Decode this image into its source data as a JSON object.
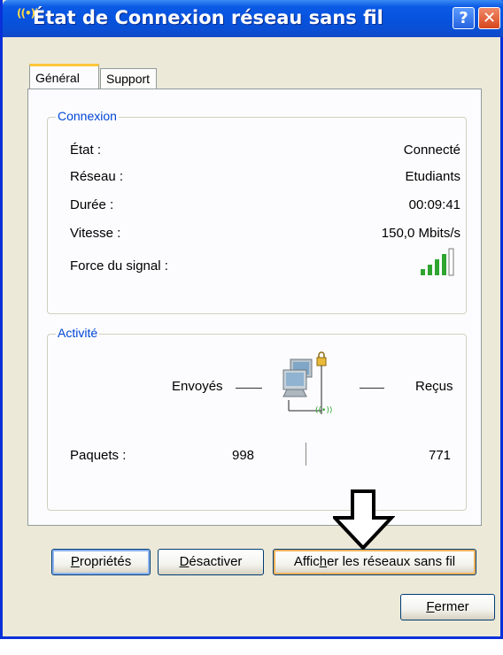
{
  "window": {
    "title": "État de Connexion réseau sans fil",
    "title_icon": "((•))",
    "help_glyph": "?",
    "close_glyph": "✕"
  },
  "tabs": [
    {
      "label": "Général",
      "active": true
    },
    {
      "label": "Support",
      "active": false
    }
  ],
  "connexion": {
    "legend": "Connexion",
    "rows": [
      {
        "label": "État :",
        "value": "Connecté"
      },
      {
        "label": "Réseau :",
        "value": "Etudiants"
      },
      {
        "label": "Durée :",
        "value": "00:09:41"
      },
      {
        "label": "Vitesse :",
        "value": "150,0 Mbits/s"
      },
      {
        "label": "Force du signal :"
      }
    ],
    "signal_bars_lit": 4,
    "signal_bars_total": 5
  },
  "activite": {
    "legend": "Activité",
    "sent_label": "Envoyés",
    "received_label": "Reçus",
    "packets_label": "Paquets :",
    "packets_sent": "998",
    "packets_received": "771"
  },
  "buttons": {
    "proprietes": {
      "pre": "",
      "key": "P",
      "post": "ropriétés"
    },
    "desactiver": {
      "pre": "",
      "key": "D",
      "post": "ésactiver"
    },
    "afficher": {
      "pre": "Affic",
      "key": "h",
      "post": "er les réseaux sans fil"
    },
    "fermer": {
      "pre": "",
      "key": "F",
      "post": "ermer"
    }
  },
  "colors": {
    "titlebar": "#0654e0",
    "accent_tab": "#ffc73c",
    "group_legend": "#0046d5",
    "signal_green": "#2fa52f"
  }
}
